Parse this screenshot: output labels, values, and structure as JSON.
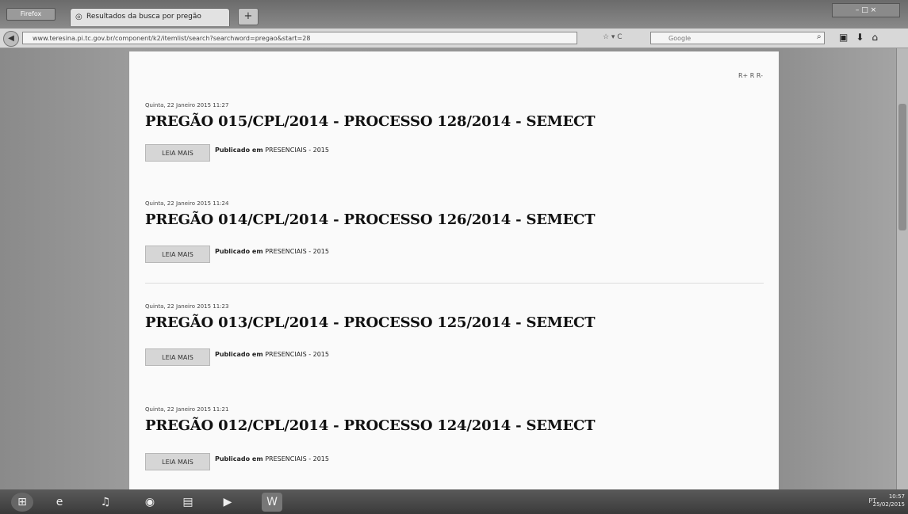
{
  "browser": {
    "app_button": "Firefox",
    "tab_title": "Resultados da busca por pregão",
    "new_tab": "+",
    "window_controls": "– □ ×",
    "url": "www.teresina.pi.tc.gov.br/component/k2/itemlist/search?searchword=pregao&start=28",
    "search_placeholder": "Google",
    "url_controls": "☆ ▾ C"
  },
  "page": {
    "font_tools": "R+ R R-",
    "read_more": "LEIA MAIS",
    "published_label": "Publicado em",
    "items": [
      {
        "date": "Quinta, 22 Janeiro 2015 11:27",
        "title": "PREGÃO 015/CPL/2014 - PROCESSO 128/2014 - SEMECT",
        "category": "PRESENCIAIS - 2015"
      },
      {
        "date": "Quinta, 22 Janeiro 2015 11:24",
        "title": "PREGÃO 014/CPL/2014 - PROCESSO 126/2014 - SEMECT",
        "category": "PRESENCIAIS - 2015"
      },
      {
        "date": "Quinta, 22 Janeiro 2015 11:23",
        "title": "PREGÃO 013/CPL/2014 - PROCESSO 125/2014 - SEMECT",
        "category": "PRESENCIAIS - 2015"
      },
      {
        "date": "Quinta, 22 Janeiro 2015 11:21",
        "title": "PREGÃO 012/CPL/2014 - PROCESSO 124/2014 - SEMECT",
        "category": "PRESENCIAIS - 2015"
      }
    ]
  },
  "taskbar": {
    "tray": "PT",
    "time": "10:57",
    "date": "25/02/2015",
    "apps": [
      "start-icon",
      "ie-icon",
      "itunes-icon",
      "chrome-icon",
      "explorer-icon",
      "media-player-icon",
      "word-icon"
    ]
  }
}
